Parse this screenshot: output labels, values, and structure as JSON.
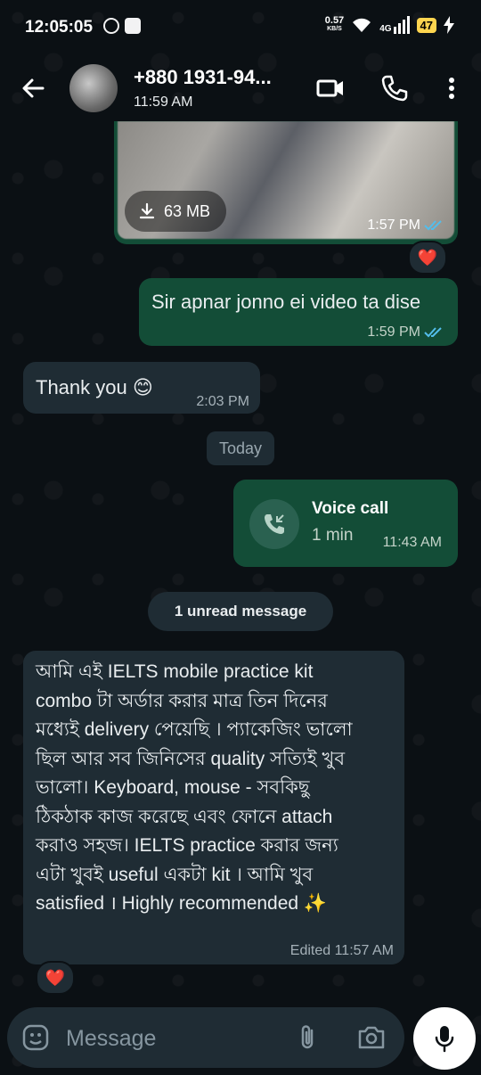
{
  "status_bar": {
    "time": "12:05:05",
    "net_speed": "0.57",
    "net_unit": "KB/S",
    "network": "4G",
    "battery": "47"
  },
  "header": {
    "contact_name": "+880 1931-94...",
    "status": "11:59 AM"
  },
  "messages": {
    "video": {
      "size": "63 MB",
      "time": "1:57 PM",
      "reaction": "❤️"
    },
    "sent1": {
      "text": "Sir apnar jonno ei video ta dise",
      "time": "1:59 PM"
    },
    "received1": {
      "text": "Thank you 😊",
      "time": "2:03 PM"
    },
    "date_divider": "Today",
    "call": {
      "title": "Voice call",
      "duration": "1 min",
      "time": "11:43 AM"
    },
    "unread_divider": "1 unread message",
    "received2": {
      "text": "আমি এই IELTS mobile practice kit combo টা অর্ডার করার মাত্র তিন দিনের মধ্যেই delivery পেয়েছি । প্যাকেজিং ভালো ছিল আর সব জিনিসের quality সত্যিই খুব ভালো। Keyboard, mouse - সবকিছু ঠিকঠাক কাজ করেছে এবং ফোনে attach  করাও সহজ। IELTS practice করার জন্য এটা খুবই useful একটা  kit । আমি খুব satisfied । Highly recommended ✨",
      "meta": "Edited 11:57 AM",
      "reaction": "❤️"
    }
  },
  "composer": {
    "placeholder": "Message"
  },
  "colors": {
    "background": "#0b1014",
    "outgoing_bubble": "#134d37",
    "incoming_bubble": "#1f2c34",
    "read_ticks": "#53bdeb",
    "heart": "#e53935"
  }
}
